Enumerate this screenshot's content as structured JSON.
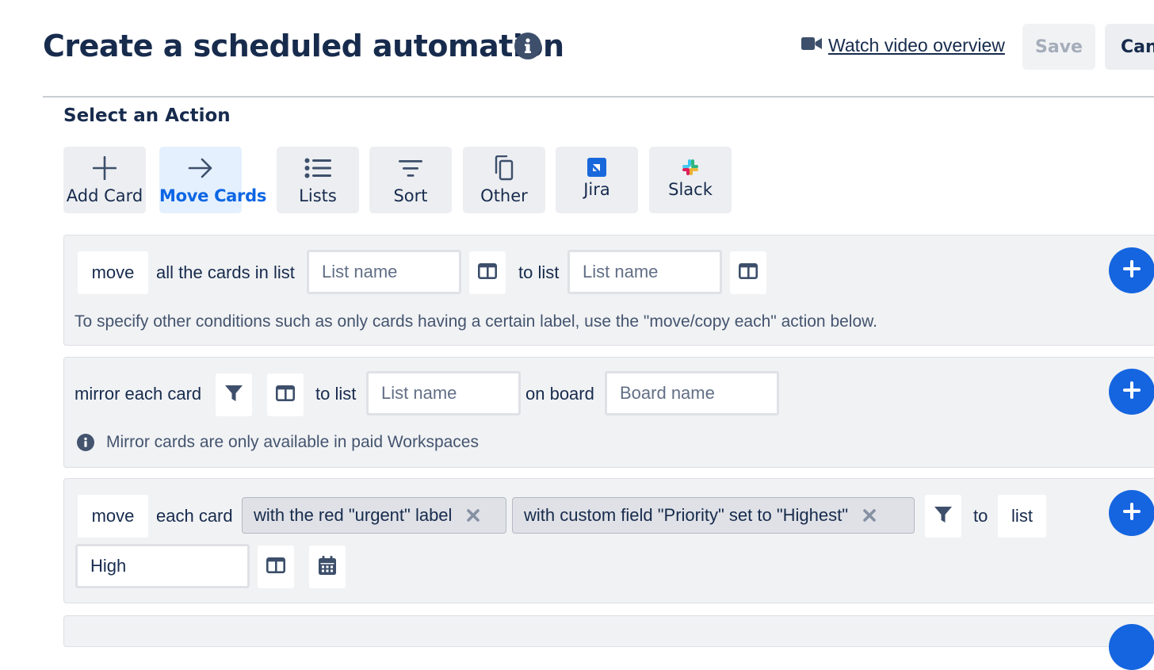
{
  "header": {
    "title": "Create a scheduled automation",
    "watch_video_label": "Watch video overview",
    "save_label": "Save",
    "cancel_label": "Can"
  },
  "section": {
    "title": "Select an Action"
  },
  "tabs": [
    {
      "label": "Add Card",
      "icon": "plus-icon",
      "active": false
    },
    {
      "label": "Move Cards",
      "icon": "arrow-right-icon",
      "active": true
    },
    {
      "label": "Lists",
      "icon": "list-icon",
      "active": false
    },
    {
      "label": "Sort",
      "icon": "sort-icon",
      "active": false
    },
    {
      "label": "Other",
      "icon": "copy-icon",
      "active": false
    },
    {
      "label": "Jira",
      "icon": "jira-icon",
      "active": false
    },
    {
      "label": "Slack",
      "icon": "slack-icon",
      "active": false
    }
  ],
  "action_move_all": {
    "verb": "move",
    "text_in_list": "all the cards in list",
    "list_placeholder": "List name",
    "text_to_list": "to list",
    "target_list_placeholder": "List name",
    "hint": "To specify other conditions such as only cards having a certain label, use the \"move/copy each\" action below."
  },
  "action_mirror": {
    "text_mirror": "mirror each card",
    "text_to_list": "to list",
    "list_placeholder": "List name",
    "text_on_board": "on board",
    "board_placeholder": "Board name",
    "info": "Mirror cards are only available in paid Workspaces"
  },
  "action_move_each": {
    "verb": "move",
    "text_each_card": "each card",
    "filters": [
      "with the red \"urgent\" label",
      "with custom field \"Priority\" set to \"Highest\""
    ],
    "text_to": "to",
    "dest_type": "list",
    "list_value": "High"
  },
  "colors": {
    "heading": "#172b4d",
    "accent": "#0c66e4",
    "add_button": "#1565e0",
    "panel_background": "#f1f2f4"
  }
}
